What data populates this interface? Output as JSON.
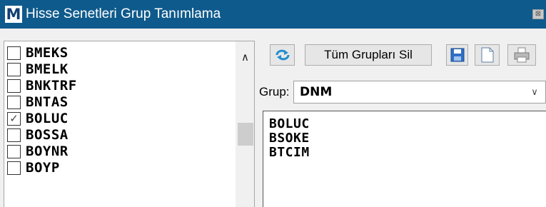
{
  "window": {
    "logo_letter": "M",
    "title": "Hisse Senetleri Grup Tanımlama",
    "close_symbol": "⊠",
    "title_bar_color": "#0f5a8c"
  },
  "stock_list": {
    "items": [
      {
        "label": "BMEKS",
        "checked": false,
        "mark": ""
      },
      {
        "label": "BMELK",
        "checked": false,
        "mark": ""
      },
      {
        "label": "BNKTRF",
        "checked": false,
        "mark": ""
      },
      {
        "label": "BNTAS",
        "checked": false,
        "mark": ""
      },
      {
        "label": "BOLUC",
        "checked": true,
        "mark": "✓"
      },
      {
        "label": "BOSSA",
        "checked": false,
        "mark": ""
      },
      {
        "label": "BOYNR",
        "checked": false,
        "mark": ""
      },
      {
        "label": "BOYP",
        "checked": false,
        "mark": ""
      }
    ],
    "scroll_up_symbol": "∧"
  },
  "toolbar": {
    "refresh_icon": "refresh-icon",
    "delete_all_label": "Tüm Grupları Sil",
    "save_icon": "save-icon",
    "new_icon": "new-document-icon",
    "print_icon": "printer-icon"
  },
  "group": {
    "label": "Grup:",
    "value": "DNM",
    "dropdown_symbol": "∨"
  },
  "members": {
    "lines": [
      "BOLUC",
      "BSOKE",
      "BTCIM"
    ]
  }
}
